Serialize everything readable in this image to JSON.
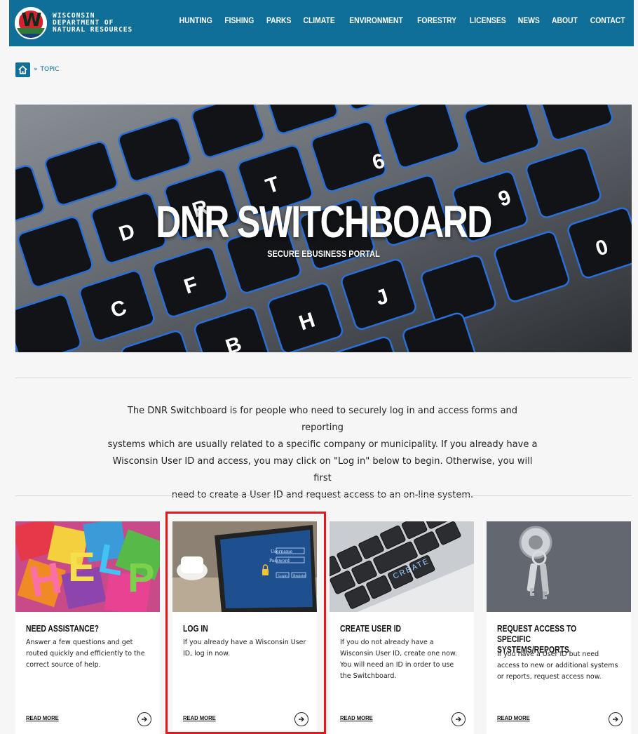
{
  "header": {
    "logo_lines": [
      "WISCONSIN",
      "DEPARTMENT OF",
      "NATURAL RESOURCES"
    ],
    "logo_letter": "W",
    "nav": [
      "HUNTING",
      "FISHING",
      "PARKS",
      "CLIMATE",
      "ENVIRONMENT",
      "FORESTRY",
      "LICENSES",
      "NEWS",
      "ABOUT",
      "CONTACT"
    ]
  },
  "breadcrumb": {
    "separator": "»",
    "current": "TOPIC",
    "home_icon": "home-icon"
  },
  "hero": {
    "title": "DNR SWITCHBOARD",
    "subtitle": "SECURE EBUSINESS PORTAL"
  },
  "intro": {
    "lines": [
      "The DNR Switchboard is for people who need to securely log in and access forms and reporting",
      "systems which are usually related to a specific company or municipality. If you already have a",
      "Wisconsin User ID and access, you may click on  \"Log in\" below to begin. Otherwise, you will first",
      "need to create a User ID and request access to an on-line system."
    ]
  },
  "cards": [
    {
      "title": "NEED ASSISTANCE?",
      "desc": "Answer a few questions and get routed quickly and efficiently to the correct source of help.",
      "read_more": "READ MORE",
      "image": "help-blocks"
    },
    {
      "title": "LOG IN",
      "desc": "If you already have a Wisconsin User ID, log in now.",
      "read_more": "READ MORE",
      "image": "tablet-login",
      "tablet_username": "Username",
      "tablet_password": "Password",
      "tablet_login": "Login",
      "tablet_register": "Register"
    },
    {
      "title": "CREATE USER ID",
      "desc": "If you do not already have a Wisconsin User ID, create one now. You will need an ID in order to use the Switchboard.",
      "read_more": "READ MORE",
      "image": "keyboard-create",
      "key_label": "CREATE"
    },
    {
      "title": "REQUEST ACCESS TO SPECIFIC SYSTEMS/REPORTS",
      "desc": "If you have a User ID but need access to new or additional systems or reports, request access now.",
      "read_more": "READ MORE",
      "image": "door-keys"
    }
  ],
  "colors": {
    "brand": "#0f6f98",
    "highlight": "#e3161c",
    "page_bg": "#f6f6f6"
  }
}
